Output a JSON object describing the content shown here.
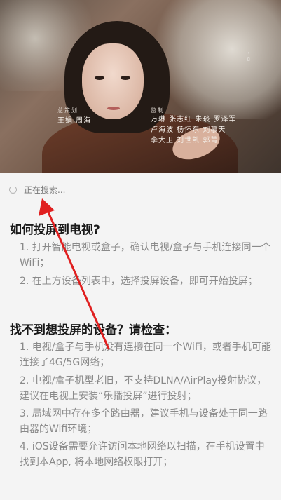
{
  "video": {
    "credit_left_head": "总策划",
    "credit_left_names": "王娟  周海",
    "credit_right_head": "监制",
    "credit_right_rows": [
      "万琳  张志红  朱琰  罗泽军",
      "卢海波  杨怀东  刘慕天",
      "李大卫  刘世凯  郭菁"
    ]
  },
  "status": {
    "searching_text": "正在搜索..."
  },
  "help": {
    "title": "如何投屏到电视?",
    "items": [
      "1. 打开智能电视或盒子，确认电视/盒子与手机连接同一个WiFi；",
      "2. 在上方设备列表中，选择投屏设备，即可开始投屏；"
    ]
  },
  "troubleshoot": {
    "title": "找不到想投屏的设备？请检查：",
    "items": [
      "1. 电视/盒子与手机没有连接在同一个WiFi，或者手机可能连接了4G/5G网络；",
      "2. 电视/盒子机型老旧，不支持DLNA/AirPlay投射协议，建议在电视上安装“乐播投屏”进行投射；",
      "3. 局域网中存在多个路由器，建议手机与设备处于同一路由器的Wifi环境；",
      "4. iOS设备需要允许访问本地网络以扫描，在手机设置中找到本App, 将本地网络权限打开；"
    ]
  },
  "colors": {
    "annotation_arrow": "#e02020",
    "background": "#f4f4f4"
  }
}
